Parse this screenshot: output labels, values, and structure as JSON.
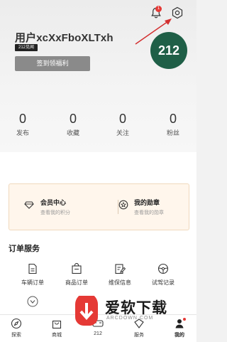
{
  "header": {
    "notification_badge": "1",
    "username": "用户xcXxFboXLTxh",
    "level_tag": "212见闻",
    "signin_label": "签到领福利",
    "avatar_text": "212"
  },
  "stats": [
    {
      "value": "0",
      "label": "发布"
    },
    {
      "value": "0",
      "label": "收藏"
    },
    {
      "value": "0",
      "label": "关注"
    },
    {
      "value": "0",
      "label": "粉丝"
    }
  ],
  "cards": [
    {
      "title": "会员中心",
      "subtitle": "查看我的积分",
      "icon": "diamond-icon"
    },
    {
      "title": "我的勋章",
      "subtitle": "查看我的勋章",
      "icon": "medal-icon"
    }
  ],
  "order_section": {
    "title": "订单服务",
    "items": [
      {
        "label": "车辆订单",
        "icon": "document-icon"
      },
      {
        "label": "商品订单",
        "icon": "shopping-bag-icon"
      },
      {
        "label": "维保信息",
        "icon": "edit-doc-icon"
      },
      {
        "label": "试驾记录",
        "icon": "steering-wheel-icon"
      }
    ]
  },
  "tabbar": [
    {
      "label": "探索",
      "icon": "compass-icon"
    },
    {
      "label": "商城",
      "icon": "shop-bag-icon"
    },
    {
      "label": "212",
      "icon": "car-icon"
    },
    {
      "label": "服务",
      "icon": "service-icon"
    },
    {
      "label": "我的",
      "icon": "person-icon"
    }
  ],
  "watermark": {
    "text": "爱软下载",
    "sub": "ARCDOWN.COM"
  },
  "colors": {
    "avatar_bg": "#1f5f47",
    "card_bg": "#fff6ec",
    "badge": "#e53935",
    "arrow": "#d32f2f"
  }
}
